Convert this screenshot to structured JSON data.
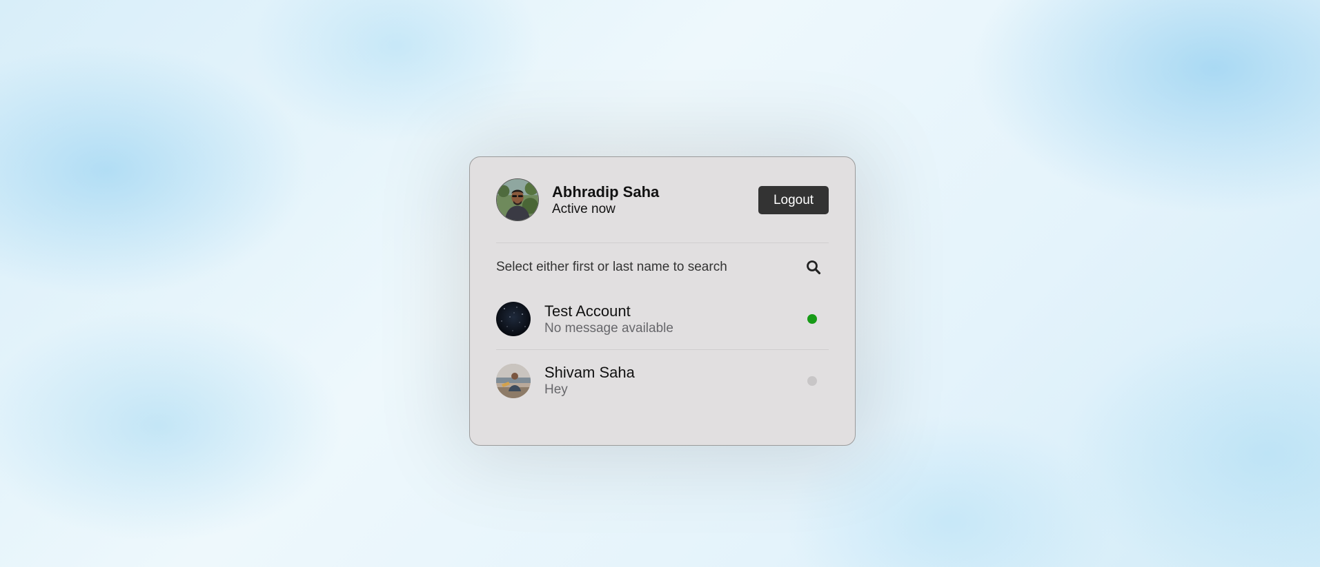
{
  "header": {
    "user_name": "Abhradip Saha",
    "status": "Active now",
    "logout_label": "Logout"
  },
  "search": {
    "text": "Select either first or last name to search",
    "icon": "search-icon"
  },
  "users": [
    {
      "name": "Test Account",
      "message": "No message available",
      "online": true,
      "status_color": "#179b17"
    },
    {
      "name": "Shivam Saha",
      "message": "Hey",
      "online": false,
      "status_color": "#c8c6c7"
    }
  ],
  "colors": {
    "card_background": "#e1dfe0",
    "button_background": "#333333",
    "online": "#179b17",
    "offline": "#c8c6c7"
  }
}
